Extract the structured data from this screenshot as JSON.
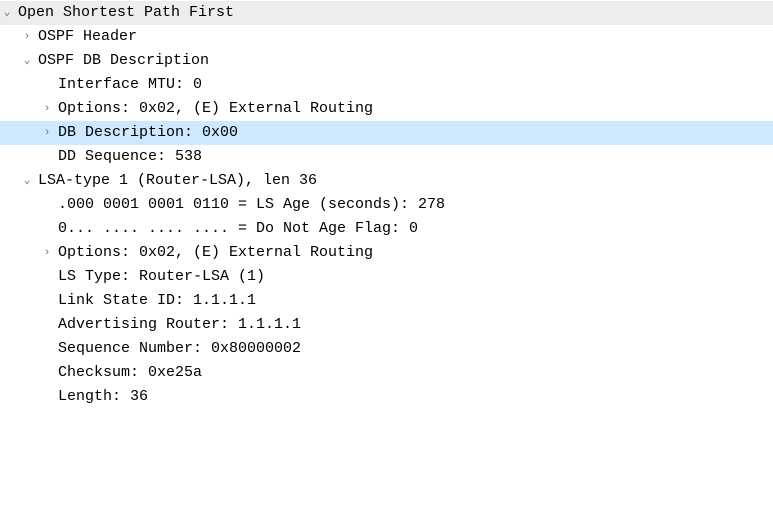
{
  "glyphs": {
    "expanded": "⌄",
    "collapsed": "›"
  },
  "root": {
    "label": "Open Shortest Path First"
  },
  "ospf_header": {
    "label": "OSPF Header"
  },
  "db_desc": {
    "label": "OSPF DB Description",
    "iface_mtu": "Interface MTU: 0",
    "options": "Options: 0x02, (E) External Routing",
    "db_description": "DB Description: 0x00",
    "dd_sequence": "DD Sequence: 538"
  },
  "lsa1": {
    "label": "LSA-type 1 (Router-LSA), len 36",
    "ls_age": ".000 0001 0001 0110 = LS Age (seconds): 278",
    "do_not_age": "0... .... .... .... = Do Not Age Flag: 0",
    "options": "Options: 0x02, (E) External Routing",
    "ls_type": "LS Type: Router-LSA (1)",
    "link_state_id": "Link State ID: 1.1.1.1",
    "adv_router": "Advertising Router: 1.1.1.1",
    "seq_num": "Sequence Number: 0x80000002",
    "checksum": "Checksum: 0xe25a",
    "length": "Length: 36"
  }
}
